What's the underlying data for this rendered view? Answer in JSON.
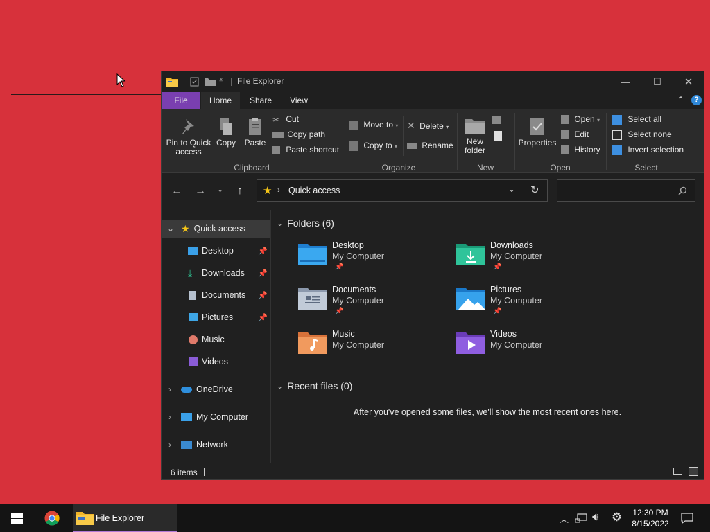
{
  "window": {
    "title": "File Explorer",
    "controls": {
      "minimize": "—",
      "maximize": "☐",
      "close": "✕"
    }
  },
  "ribbon_tabs": [
    "File",
    "Home",
    "Share",
    "View"
  ],
  "ribbon": {
    "clipboard": {
      "pin": "Pin to Quick access",
      "copy": "Copy",
      "paste": "Paste",
      "cut": "Cut",
      "copy_path": "Copy path",
      "paste_shortcut": "Paste shortcut",
      "label": "Clipboard"
    },
    "organize": {
      "move_to": "Move to",
      "copy_to": "Copy to",
      "delete": "Delete",
      "rename": "Rename",
      "label": "Organize"
    },
    "new": {
      "new_folder": "New folder",
      "label": "New"
    },
    "open": {
      "properties": "Properties",
      "open": "Open",
      "edit": "Edit",
      "history": "History",
      "label": "Open"
    },
    "select": {
      "select_all": "Select all",
      "select_none": "Select none",
      "invert": "Invert selection",
      "label": "Select"
    }
  },
  "address": {
    "location": "Quick access",
    "search_placeholder": ""
  },
  "nav": {
    "quick_access": "Quick access",
    "items": [
      {
        "label": "Desktop",
        "pinned": true
      },
      {
        "label": "Downloads",
        "pinned": true
      },
      {
        "label": "Documents",
        "pinned": true
      },
      {
        "label": "Pictures",
        "pinned": true
      },
      {
        "label": "Music",
        "pinned": false
      },
      {
        "label": "Videos",
        "pinned": false
      }
    ],
    "onedrive": "OneDrive",
    "my_computer": "My Computer",
    "network": "Network"
  },
  "folders": {
    "header": "Folders (6)",
    "items": [
      {
        "name": "Desktop",
        "location": "My Computer",
        "pinned": true
      },
      {
        "name": "Downloads",
        "location": "My Computer",
        "pinned": true
      },
      {
        "name": "Documents",
        "location": "My Computer",
        "pinned": true
      },
      {
        "name": "Pictures",
        "location": "My Computer",
        "pinned": true
      },
      {
        "name": "Music",
        "location": "My Computer",
        "pinned": false
      },
      {
        "name": "Videos",
        "location": "My Computer",
        "pinned": false
      }
    ]
  },
  "recent": {
    "header": "Recent files (0)",
    "empty_message": "After you've opened some files, we'll show the most recent ones here."
  },
  "status": {
    "item_count": "6 items"
  },
  "taskbar": {
    "app_label": "File Explorer",
    "time": "12:30 PM",
    "date": "8/15/2022"
  },
  "colors": {
    "desktop": "#d7313b",
    "file_tab": "#7a3fb0",
    "accent_blue": "#2f88d8"
  }
}
